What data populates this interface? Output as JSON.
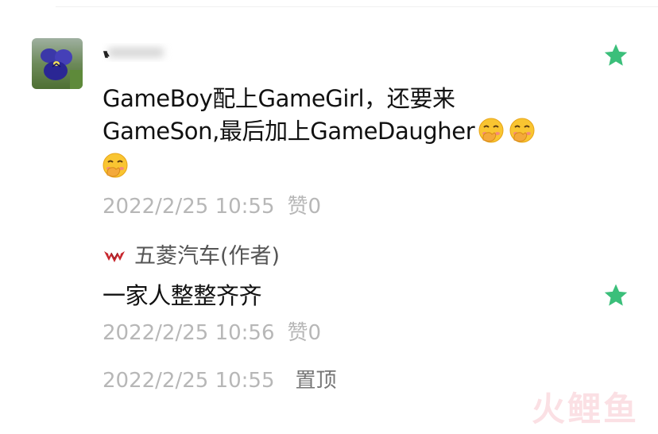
{
  "comment": {
    "username": "",
    "text_line_1": "GameBoy配上GameGirl，还要来",
    "text_line_2": "GameSon,最后加上GameDaugher",
    "emoji_name": "face-with-hand-over-mouth",
    "emoji_count": 3,
    "timestamp": "2022/2/25 10:55",
    "like_label": "赞0",
    "starred": true
  },
  "reply": {
    "author": "五菱汽车(作者)",
    "text": "一家人整整齐齐",
    "timestamp": "2022/2/25 10:56",
    "like_label": "赞0",
    "starred": true
  },
  "pinned": {
    "timestamp": "2022/2/25 10:55",
    "action_label": "置顶"
  },
  "colors": {
    "star": "#3bbf7a",
    "text": "#111111",
    "meta": "#b7b7b7",
    "watermark": "#e8546c"
  },
  "icons": {
    "star": "star-icon",
    "avatar": "avatar",
    "brand": "wuling-logo-icon"
  },
  "watermark": "火鲤鱼"
}
